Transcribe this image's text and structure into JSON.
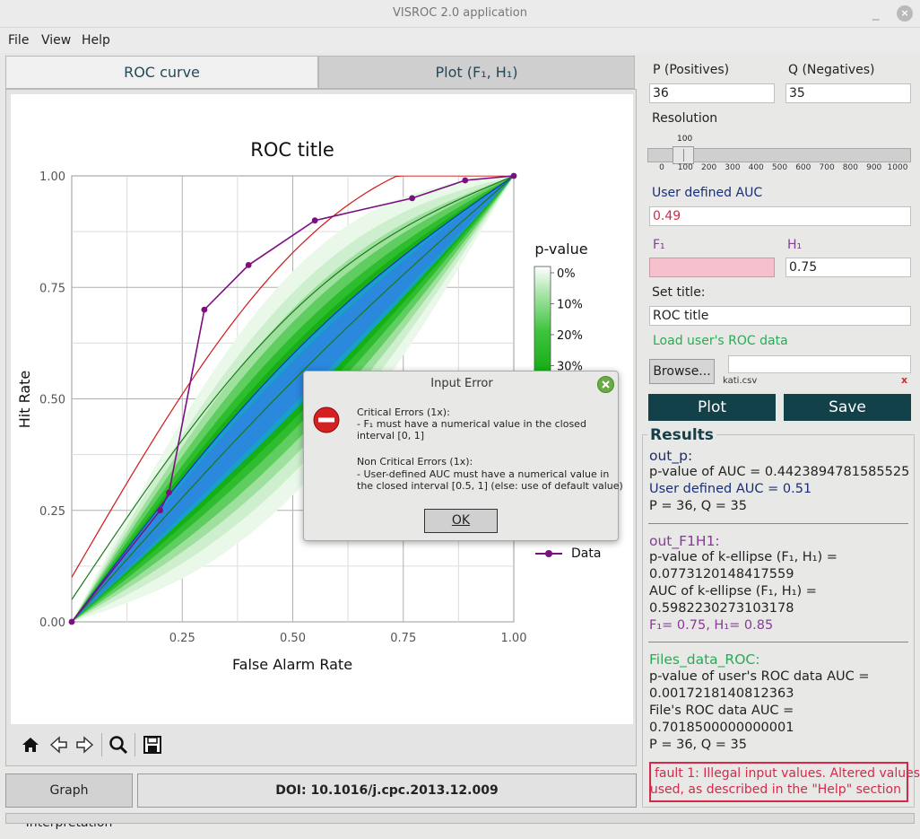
{
  "window": {
    "title": "VISROC 2.0 application",
    "minimize": "_",
    "close": "×"
  },
  "menu": [
    "File",
    "View",
    "Help"
  ],
  "tabs": {
    "roc": "ROC curve",
    "plot": "Plot (F₁, H₁)"
  },
  "chart_data": {
    "type": "line",
    "title": "ROC title",
    "xlabel": "False Alarm Rate",
    "ylabel": "Hit Rate",
    "xlim": [
      0,
      1
    ],
    "ylim": [
      0,
      1
    ],
    "xticks": [
      "0.25",
      "0.50",
      "0.75",
      "1.00"
    ],
    "yticks": [
      "0.00",
      "0.25",
      "0.50",
      "0.75",
      "1.00"
    ],
    "grid": true,
    "series": [
      {
        "name": "Data",
        "color": "#7a1080",
        "x": [
          0,
          0.2,
          0.22,
          0.3,
          0.4,
          0.55,
          0.77,
          0.89,
          1.0
        ],
        "y": [
          0,
          0.25,
          0.29,
          0.7,
          0.8,
          0.9,
          0.95,
          0.99,
          1.0
        ]
      }
    ],
    "colorbar": {
      "title": "p-value",
      "ticks": [
        "0%",
        "10%",
        "20%",
        "30%"
      ]
    },
    "legend": "right"
  },
  "toolbar": {
    "home": "home-icon",
    "back": "back-icon",
    "forward": "forward-icon",
    "zoom": "zoom-icon",
    "save": "save-icon"
  },
  "bottom": {
    "graph_interp": "Graph Interpretation",
    "doi": "DOI: 10.1016/j.cpc.2013.12.009"
  },
  "inputs": {
    "p_label": "P (Positives)",
    "p_value": "36",
    "q_label": "Q (Negatives)",
    "q_value": "35",
    "resolution_label": "Resolution",
    "resolution_value": "100",
    "resolution_ticks": [
      "0",
      "100",
      "200",
      "300",
      "400",
      "500",
      "600",
      "700",
      "800",
      "900",
      "1000"
    ],
    "auc_label": "User defined AUC",
    "auc_value": "0.49",
    "f1_label": "F₁",
    "f1_value": "",
    "h1_label": "H₁",
    "h1_value": "0.75",
    "title_label": "Set title:",
    "title_value": "ROC title",
    "load_label": "Load user's ROC data",
    "browse": "Browse...",
    "file_value": "",
    "file_name": "kati.csv",
    "file_clear": "x",
    "plot": "Plot",
    "save": "Save"
  },
  "results": {
    "legend": "Results",
    "out_p_head": "out_p:",
    "pvalue_auc": "p-value of AUC = 0.4423894781585525",
    "user_auc": "User defined AUC = 0.51",
    "pq1": "P = 36, Q = 35",
    "out_f1h1_head": "out_F1H1:",
    "pvalue_ellipse": "p-value of k-ellipse (F₁, H₁) =",
    "pvalue_ellipse_val": "0.0773120148417559",
    "auc_ellipse": "AUC of k-ellipse (F₁, H₁) =",
    "auc_ellipse_val": "0.5982230273103178",
    "f1h1": "F₁= 0.75, H₁= 0.85",
    "files_head": "Files_data_ROC:",
    "pvalue_user_roc": "p-value of user's ROC data AUC =",
    "pvalue_user_roc_val": "0.0017218140812363",
    "file_auc": "File's ROC data AUC =",
    "file_auc_val": "0.7018500000000001",
    "pq2": "P = 36, Q = 35"
  },
  "fault": {
    "line1": "fault 1:    Illegal input values. Altered values",
    "line2": "used, as described in the \"Help\" section"
  },
  "dialog": {
    "title": "Input Error",
    "crit_head": "Critical Errors (1x):",
    "crit_1": " - F₁ must have a numerical value in the closed",
    "crit_2": "interval [0, 1]",
    "noncrit_head": "Non Critical Errors (1x):",
    "noncrit_1": " - User-defined AUC must have a numerical value in",
    "noncrit_2": "the closed interval [0.5, 1] (else: use of default value)",
    "ok": "OK"
  }
}
